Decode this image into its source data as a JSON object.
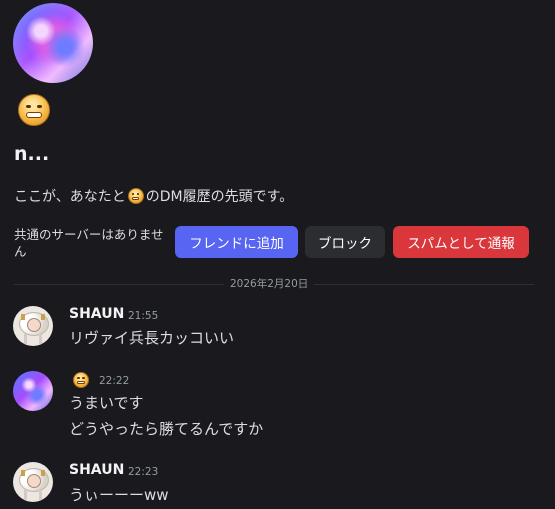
{
  "profile": {
    "username": "n...",
    "intro_before": "ここが、あなたと",
    "intro_after": "のDM履歴の先頭です。",
    "mutual_servers": "共通のサーバーはありません"
  },
  "actions": {
    "add_friend": "フレンドに追加",
    "block": "ブロック",
    "report_spam": "スパムとして通報"
  },
  "date_divider": "2026年2月20日",
  "messages": [
    {
      "author": "SHAUN",
      "time": "21:55",
      "lines": [
        "リヴァイ兵長カッコいい"
      ]
    },
    {
      "author": "",
      "time": "22:22",
      "lines": [
        "うまいです",
        "どうやったら勝てるんですか"
      ]
    },
    {
      "author": "SHAUN",
      "time": "22:23",
      "lines": [
        "うぃーーーww"
      ]
    }
  ],
  "colors": {
    "background": "#1a1a1e",
    "friend_button": "#5865f2",
    "block_button": "#2b2d31",
    "spam_button": "#da373c"
  }
}
